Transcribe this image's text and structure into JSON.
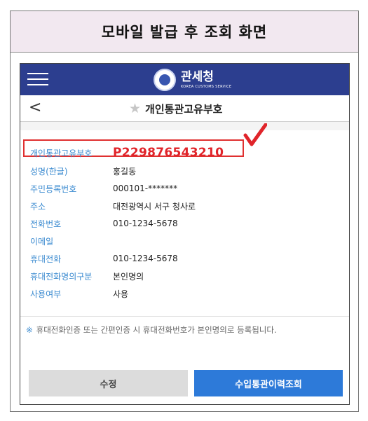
{
  "caption": "모바일 발급 후 조회 화면",
  "header": {
    "brand_ko": "관세청",
    "brand_en": "KOREA CUSTOMS SERVICE"
  },
  "subheader": {
    "back_glyph": "<",
    "star_glyph": "★",
    "title": "개인통관고유부호"
  },
  "fields": [
    {
      "label": "개인통관고유부호",
      "value": "P229876543210"
    },
    {
      "label": "성명(한글)",
      "value": "홍길동"
    },
    {
      "label": "주민등록번호",
      "value": "000101-*******"
    },
    {
      "label": "주소",
      "value": "대전광역시 서구 청사로"
    },
    {
      "label": "전화번호",
      "value": "010-1234-5678"
    },
    {
      "label": "이메일",
      "value": ""
    },
    {
      "label": "휴대전화",
      "value": "010-1234-5678"
    },
    {
      "label": "휴대전화명의구분",
      "value": "본인명의"
    },
    {
      "label": "사용여부",
      "value": "사용"
    }
  ],
  "notice": {
    "mark": "※",
    "text": "휴대전화인증 또는 간편인증 시 휴대전화번호가 본인명의로 등록됩니다."
  },
  "buttons": {
    "edit": "수정",
    "history": "수입통관이력조회"
  },
  "colors": {
    "header_bg": "#2c3e8f",
    "label_blue": "#3a8ad0",
    "highlight_red": "#e0242a",
    "primary_button": "#2d7ad9"
  },
  "icons": [
    "menu-icon",
    "customs-emblem-icon",
    "back-chevron-icon",
    "star-icon",
    "checkmark-icon"
  ]
}
